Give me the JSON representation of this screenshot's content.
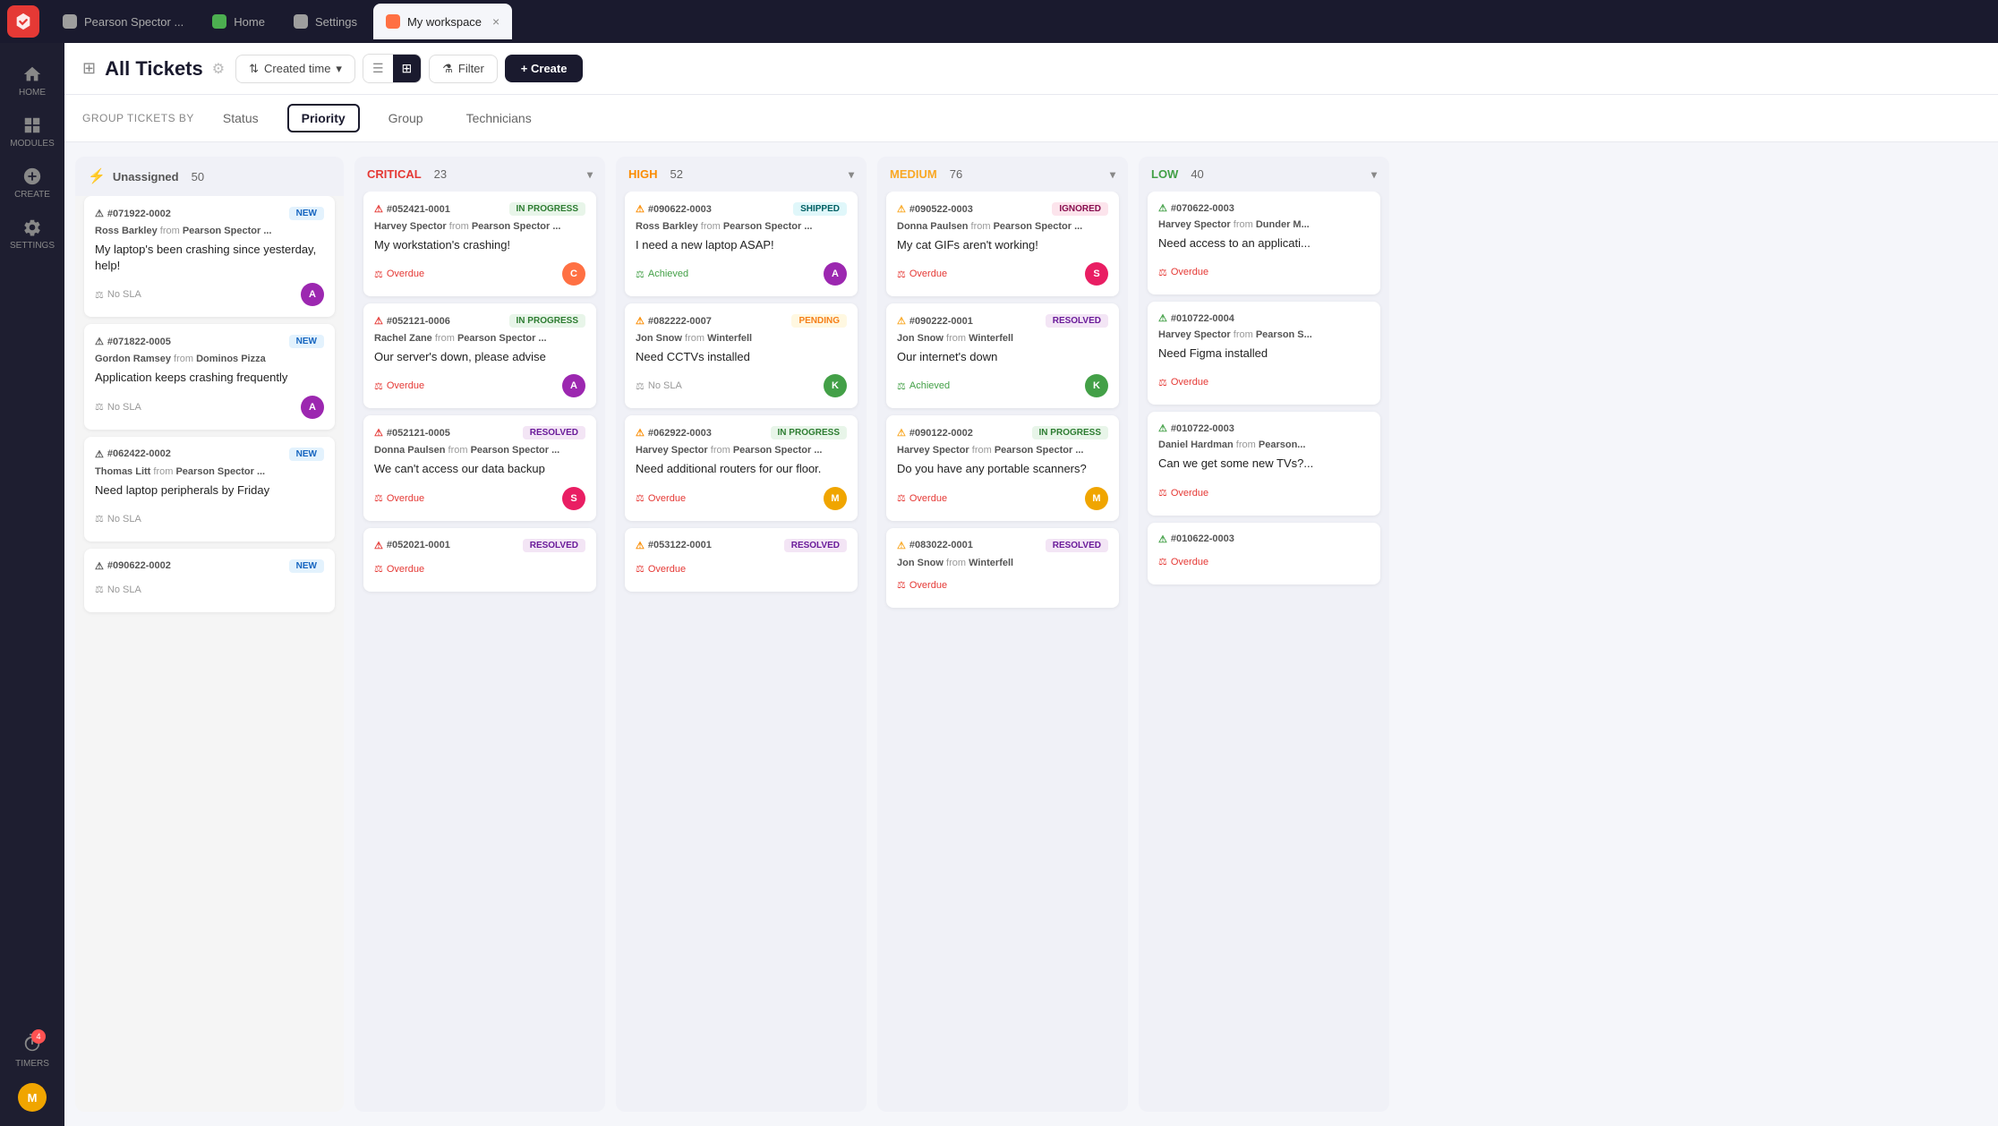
{
  "tabs": [
    {
      "id": "pearson",
      "label": "Pearson Spector ...",
      "icon_color": "#9e9e9e",
      "active": false
    },
    {
      "id": "home",
      "label": "Home",
      "icon_color": "#4caf50",
      "active": false
    },
    {
      "id": "settings",
      "label": "Settings",
      "icon_color": "#9e9e9e",
      "active": false
    },
    {
      "id": "workspace",
      "label": "My workspace",
      "icon_color": "#ff7043",
      "active": true,
      "closable": true
    }
  ],
  "sidebar": {
    "items": [
      {
        "id": "home",
        "label": "HOME",
        "active": false
      },
      {
        "id": "modules",
        "label": "MODULES",
        "active": false
      },
      {
        "id": "create",
        "label": "CREATE",
        "active": false
      },
      {
        "id": "settings",
        "label": "SETTINGS",
        "active": false
      }
    ],
    "timer_badge": "4",
    "user_initial": "M"
  },
  "header": {
    "title": "All Tickets",
    "sort_label": "Created time",
    "filter_label": "Filter",
    "create_label": "+ Create"
  },
  "group_by": {
    "label": "GROUP TICKETS BY",
    "options": [
      "Status",
      "Priority",
      "Group",
      "Technicians"
    ],
    "active": "Priority"
  },
  "columns": [
    {
      "id": "unassigned",
      "title": "Unassigned",
      "count": 50,
      "type": "unassigned",
      "cards": [
        {
          "id": "#071922-0002",
          "status": "NEW",
          "status_type": "new",
          "from_name": "Ross Barkley",
          "from_org": "Pearson Spector ...",
          "title": "My laptop's been crashing since yesterday, help!",
          "sla": "No SLA",
          "sla_type": "none",
          "assignee": "A",
          "assignee_color": "#9c27b0"
        },
        {
          "id": "#071822-0005",
          "status": "NEW",
          "status_type": "new",
          "from_name": "Gordon Ramsey",
          "from_org": "Dominos Pizza",
          "title": "Application keeps crashing frequently",
          "sla": "No SLA",
          "sla_type": "none",
          "assignee": "A",
          "assignee_color": "#9c27b0"
        },
        {
          "id": "#062422-0002",
          "status": "NEW",
          "status_type": "new",
          "from_name": "Thomas Litt",
          "from_org": "Pearson Spector ...",
          "title": "Need laptop peripherals by Friday",
          "sla": "No SLA",
          "sla_type": "none",
          "assignee": null,
          "assignee_color": null
        },
        {
          "id": "#090622-0002",
          "status": "NEW",
          "status_type": "new",
          "from_name": "",
          "from_org": "",
          "title": "",
          "sla": "No SLA",
          "sla_type": "none",
          "assignee": null,
          "assignee_color": null
        }
      ]
    },
    {
      "id": "critical",
      "title": "CRITICAL",
      "count": 23,
      "type": "critical",
      "cards": [
        {
          "id": "#052421-0001",
          "status": "IN PROGRESS",
          "status_type": "inprogress",
          "from_name": "Harvey Spector",
          "from_org": "Pearson Spector ...",
          "title": "My workstation's crashing!",
          "sla": "Overdue",
          "sla_type": "overdue",
          "assignee": "C",
          "assignee_color": "#ff7043"
        },
        {
          "id": "#052121-0006",
          "status": "IN PROGRESS",
          "status_type": "inprogress",
          "from_name": "Rachel Zane",
          "from_org": "Pearson Spector ...",
          "title": "Our server's down, please advise",
          "sla": "Overdue",
          "sla_type": "overdue",
          "assignee": "A",
          "assignee_color": "#9c27b0"
        },
        {
          "id": "#052121-0005",
          "status": "RESOLVED",
          "status_type": "resolved",
          "from_name": "Donna Paulsen",
          "from_org": "Pearson Spector ...",
          "title": "We can't access our data backup",
          "sla": "Overdue",
          "sla_type": "overdue",
          "assignee": "S",
          "assignee_color": "#e91e63"
        },
        {
          "id": "#052021-0001",
          "status": "RESOLVED",
          "status_type": "resolved",
          "from_name": "",
          "from_org": "",
          "title": "",
          "sla": "Overdue",
          "sla_type": "overdue",
          "assignee": null,
          "assignee_color": null
        }
      ]
    },
    {
      "id": "high",
      "title": "HIGH",
      "count": 52,
      "type": "high",
      "cards": [
        {
          "id": "#090622-0003",
          "status": "SHIPPED",
          "status_type": "shipped",
          "from_name": "Ross Barkley",
          "from_org": "Pearson Spector ...",
          "title": "I need a new laptop ASAP!",
          "sla": "Achieved",
          "sla_type": "achieved",
          "assignee": "A",
          "assignee_color": "#9c27b0"
        },
        {
          "id": "#082222-0007",
          "status": "PENDING",
          "status_type": "pending",
          "from_name": "Jon Snow",
          "from_org": "Winterfell",
          "title": "Need CCTVs installed",
          "sla": "No SLA",
          "sla_type": "none",
          "assignee": "K",
          "assignee_color": "#43a047"
        },
        {
          "id": "#062922-0003",
          "status": "IN PROGRESS",
          "status_type": "inprogress",
          "from_name": "Harvey Spector",
          "from_org": "Pearson Spector ...",
          "title": "Need additional routers for our floor.",
          "sla": "Overdue",
          "sla_type": "overdue",
          "assignee": "M",
          "assignee_color": "#f0a500"
        },
        {
          "id": "#053122-0001",
          "status": "RESOLVED",
          "status_type": "resolved",
          "from_name": "",
          "from_org": "",
          "title": "",
          "sla": "Overdue",
          "sla_type": "overdue",
          "assignee": null,
          "assignee_color": null
        }
      ]
    },
    {
      "id": "medium",
      "title": "MEDIUM",
      "count": 76,
      "type": "medium",
      "cards": [
        {
          "id": "#090522-0003",
          "status": "IGNORED",
          "status_type": "ignored",
          "from_name": "Donna Paulsen",
          "from_org": "Pearson Spector ...",
          "title": "My cat GIFs aren't working!",
          "sla": "Overdue",
          "sla_type": "overdue",
          "assignee": "S",
          "assignee_color": "#e91e63"
        },
        {
          "id": "#090222-0001",
          "status": "RESOLVED",
          "status_type": "resolved",
          "from_name": "Jon Snow",
          "from_org": "Winterfell",
          "title": "Our internet's down",
          "sla": "Achieved",
          "sla_type": "achieved",
          "assignee": "K",
          "assignee_color": "#43a047"
        },
        {
          "id": "#090122-0002",
          "status": "IN PROGRESS",
          "status_type": "inprogress",
          "from_name": "Harvey Spector",
          "from_org": "Pearson Spector ...",
          "title": "Do you have any portable scanners?",
          "sla": "Overdue",
          "sla_type": "overdue",
          "assignee": "M",
          "assignee_color": "#f0a500"
        },
        {
          "id": "#083022-0001",
          "status": "RESOLVED",
          "status_type": "resolved",
          "from_name": "Jon Snow",
          "from_org": "Winterfell",
          "title": "",
          "sla": "Overdue",
          "sla_type": "overdue",
          "assignee": null,
          "assignee_color": null
        }
      ]
    },
    {
      "id": "low",
      "title": "LOW",
      "count": 40,
      "type": "low",
      "cards": [
        {
          "id": "#070622-0003",
          "status": null,
          "status_type": null,
          "from_name": "Harvey Spector",
          "from_org": "Dunder M...",
          "title": "Need access to an applicati...",
          "sla": "Overdue",
          "sla_type": "overdue",
          "assignee": null,
          "assignee_color": null
        },
        {
          "id": "#010722-0004",
          "status": null,
          "status_type": null,
          "from_name": "Harvey Spector",
          "from_org": "Pearson S...",
          "title": "Need Figma installed",
          "sla": "Overdue",
          "sla_type": "overdue",
          "assignee": null,
          "assignee_color": null
        },
        {
          "id": "#010722-0003",
          "status": null,
          "status_type": null,
          "from_name": "Daniel Hardman",
          "from_org": "Pearson...",
          "title": "Can we get some new TVs?...",
          "sla": "Overdue",
          "sla_type": "overdue",
          "assignee": null,
          "assignee_color": null
        },
        {
          "id": "#010622-0003",
          "status": null,
          "status_type": null,
          "from_name": "",
          "from_org": "",
          "title": "",
          "sla": "Overdue",
          "sla_type": "overdue",
          "assignee": null,
          "assignee_color": null
        }
      ]
    }
  ]
}
